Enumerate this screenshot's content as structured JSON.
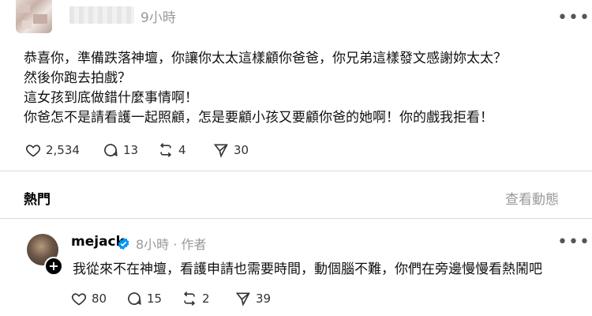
{
  "post": {
    "time": "9小時",
    "text_lines": [
      "恭喜你，準備跌落神壇，你讓你太太這樣顧你爸爸，你兄弟這樣發文感謝妳太太？",
      "然後你跑去拍戲？",
      "這女孩到底做錯什麼事情啊！",
      "你爸怎不是請看護一起照顧，怎是要顧小孩又要顧你爸的她啊！你的戲我拒看！"
    ],
    "likes": "2,534",
    "comments": "13",
    "reposts": "4",
    "shares": "30",
    "more_icon": "more-horizontal-icon"
  },
  "section": {
    "hot_label": "熱門",
    "view_activity_label": "查看動態"
  },
  "reply": {
    "username": "mejack",
    "time_author": "8小時 · 作者",
    "text": "我從來不在神壇，看護申請也需要時間，動個腦不難，你們在旁邊慢慢看熱鬧吧",
    "likes": "80",
    "comments": "15",
    "reposts": "2",
    "shares": "39"
  },
  "colors": {
    "muted": "#999999",
    "verified_blue": "#0095f6",
    "divider": "#dcdcdc"
  }
}
